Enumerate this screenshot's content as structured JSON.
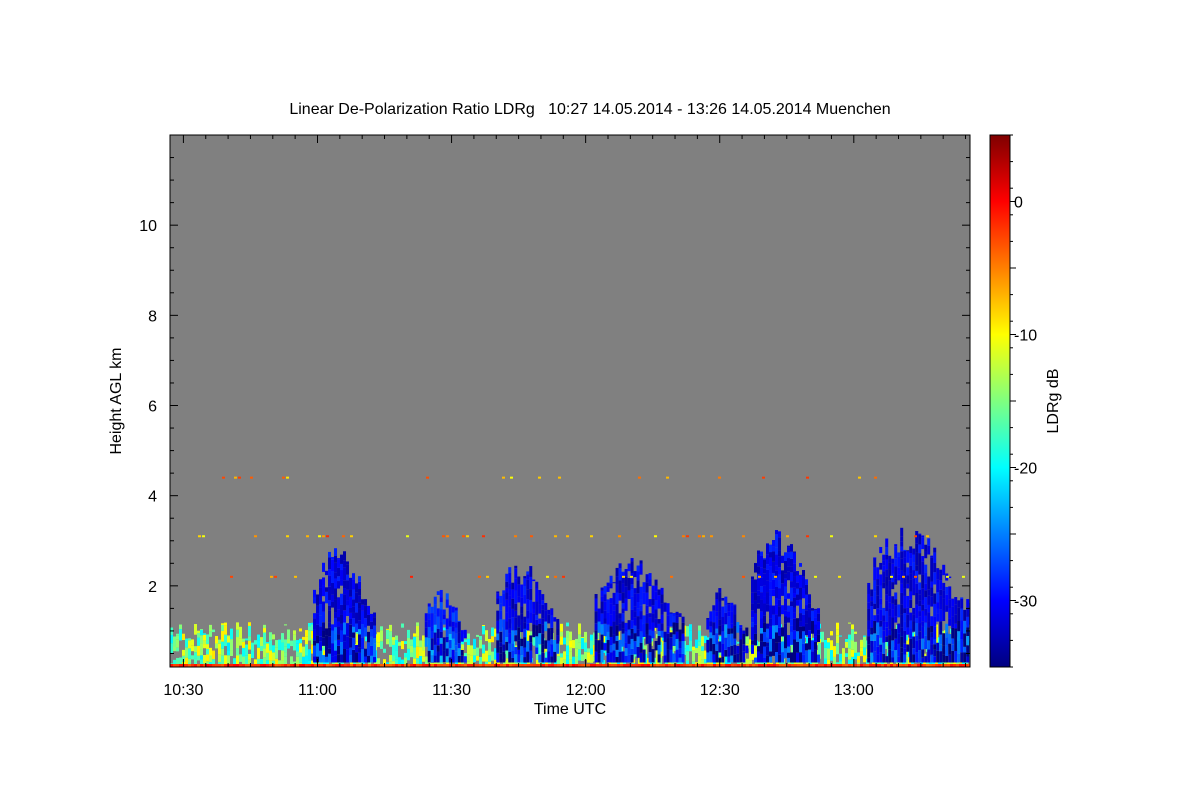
{
  "chart_data": {
    "type": "heatmap",
    "title": "Linear De-Polarization Ratio LDRg   10:27 14.05.2014 - 13:26 14.05.2014 Muenchen",
    "xlabel": "Time UTC",
    "ylabel": "Height AGL km",
    "x_tick_labels": [
      "10:30",
      "11:00",
      "11:30",
      "12:00",
      "12:30",
      "13:00"
    ],
    "x_tick_minutes": [
      30,
      60,
      90,
      120,
      150,
      180
    ],
    "xlim_minutes": [
      27,
      206
    ],
    "ylim": [
      0.2,
      12
    ],
    "y_ticks": [
      2,
      4,
      6,
      8,
      10
    ],
    "colorbar": {
      "label": "LDRg dB",
      "range": [
        -35,
        5
      ],
      "ticks": [
        0,
        -10,
        -20,
        -30
      ],
      "colormap": "jet"
    },
    "background_color": "#808080",
    "cloud_regions": [
      {
        "start": "10:59",
        "end": "11:13",
        "top_km": 2.9,
        "ldr_db": -31
      },
      {
        "start": "11:24",
        "end": "11:33",
        "top_km": 2.1,
        "ldr_db": -29
      },
      {
        "start": "11:40",
        "end": "11:54",
        "top_km": 2.6,
        "ldr_db": -31
      },
      {
        "start": "12:02",
        "end": "12:22",
        "top_km": 2.7,
        "ldr_db": -31
      },
      {
        "start": "12:27",
        "end": "12:36",
        "top_km": 2.0,
        "ldr_db": -31
      },
      {
        "start": "12:37",
        "end": "12:52",
        "top_km": 3.3,
        "ldr_db": -31
      },
      {
        "start": "13:03",
        "end": "13:26",
        "top_km": 3.4,
        "ldr_db": -31
      }
    ],
    "boundary_layer": {
      "top_km": 1.2,
      "ldr_db": -15
    },
    "sparse_returns_km": [
      4.4,
      3.1,
      2.2
    ],
    "grid": false,
    "legend": "none"
  }
}
